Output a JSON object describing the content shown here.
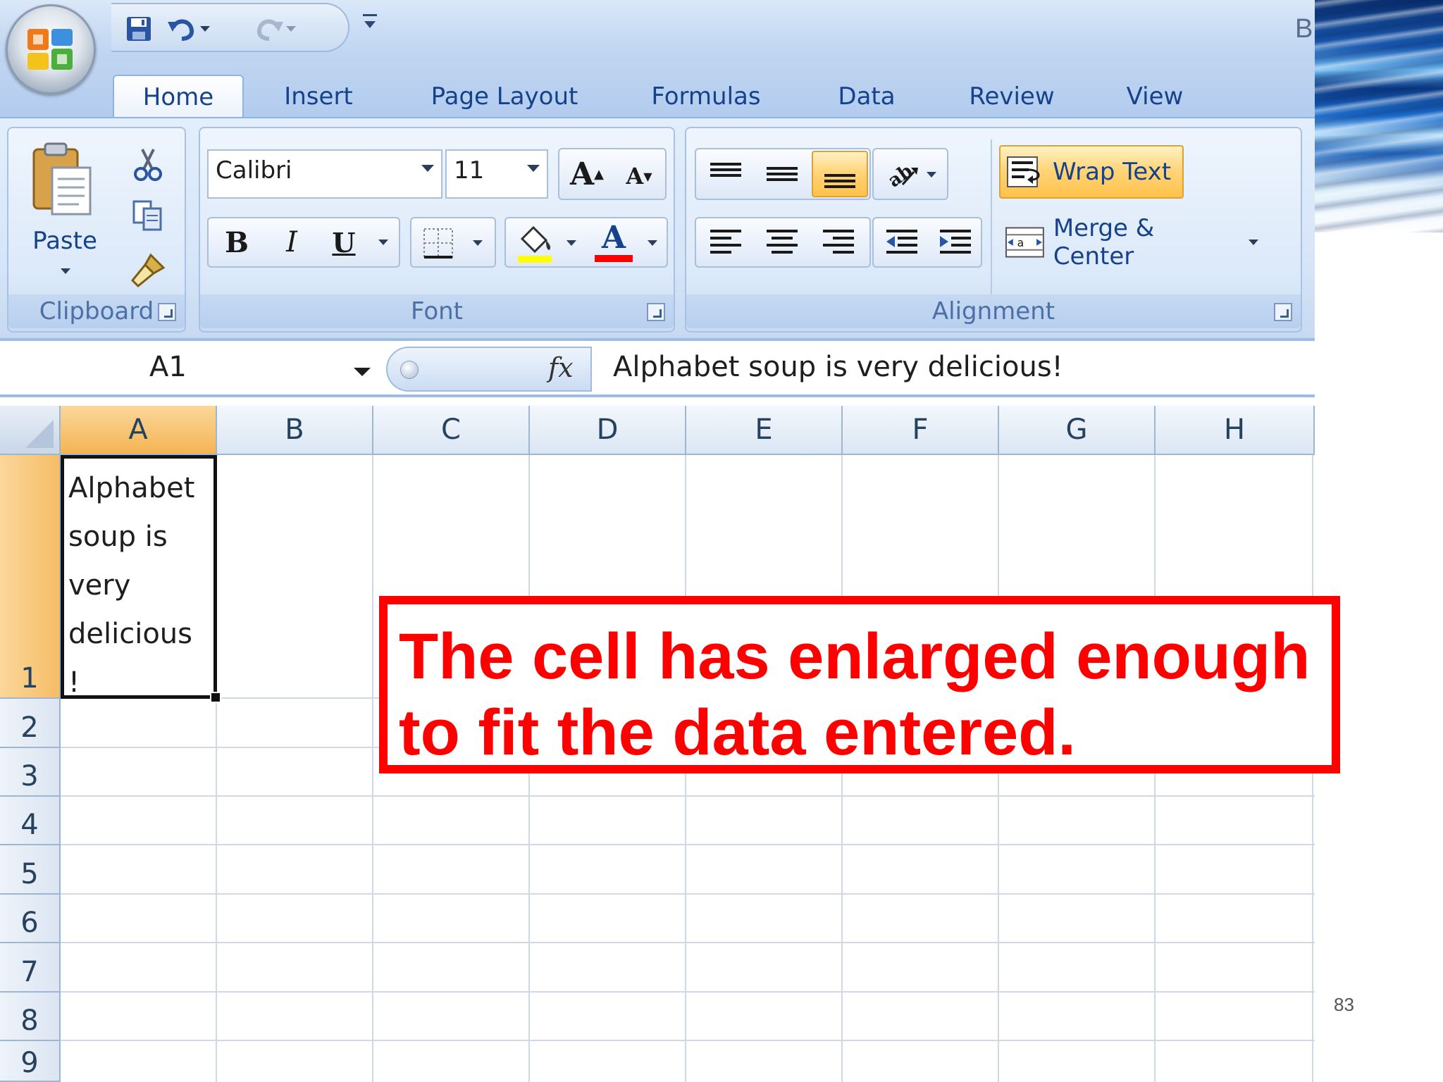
{
  "title_bar": {
    "title_fragment": "B"
  },
  "ribbon": {
    "tabs": [
      "Home",
      "Insert",
      "Page Layout",
      "Formulas",
      "Data",
      "Review",
      "View"
    ],
    "active_tab": "Home",
    "clipboard": {
      "group_label": "Clipboard",
      "paste_label": "Paste"
    },
    "font": {
      "group_label": "Font",
      "font_name": "Calibri",
      "font_size": "11",
      "bold_glyph": "B",
      "italic_glyph": "I",
      "underline_glyph": "U",
      "font_color_glyph": "A",
      "highlight_color": "#ffff00",
      "font_color": "#ff0000"
    },
    "alignment": {
      "group_label": "Alignment",
      "wrap_text_label": "Wrap Text",
      "wrap_text_active": true,
      "merge_center_label": "Merge & Center",
      "active_vertical_align": "bottom"
    }
  },
  "formula_bar": {
    "name_box": "A1",
    "fx_label": "fx",
    "value": "Alphabet soup is very delicious!"
  },
  "sheet": {
    "columns": [
      "A",
      "B",
      "C",
      "D",
      "E",
      "F",
      "G",
      "H"
    ],
    "rows": [
      "1",
      "2",
      "3",
      "4",
      "5",
      "6",
      "7",
      "8",
      "9"
    ],
    "selected_cell": "A1",
    "a1_text": "Alphabet\nsoup is\nvery\ndelicious\n!"
  },
  "annotation": {
    "text": "The cell has enlarged enough to fit the data entered.",
    "color": "#ff0000"
  },
  "slide": {
    "page_number": "83"
  },
  "icons": [
    "office-button",
    "save-icon",
    "undo-icon",
    "redo-icon",
    "customize-qat-icon",
    "paste-icon",
    "cut-icon",
    "copy-icon",
    "format-painter-icon",
    "grow-font-icon",
    "shrink-font-icon",
    "borders-icon",
    "fill-color-icon",
    "font-color-icon",
    "orientation-icon",
    "wrap-text-icon",
    "merge-center-icon",
    "decrease-indent-icon",
    "increase-indent-icon",
    "dialog-launcher-icon"
  ]
}
